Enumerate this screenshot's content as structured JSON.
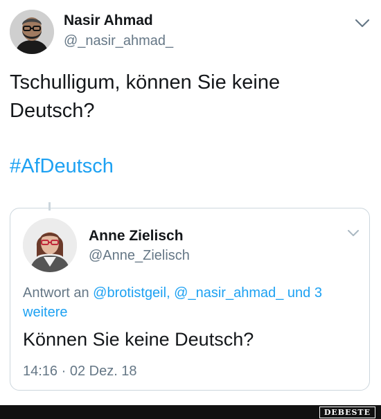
{
  "tweet": {
    "author_name": "Nasir Ahmad",
    "author_handle": "@_nasir_ahmad_",
    "text_line1": "Tschulligum, können Sie keine",
    "text_line2": "Deutsch?",
    "hashtag": "#AfDeutsch",
    "menu_icon": "chevron-down-icon"
  },
  "quoted_tweet": {
    "author_name": "Anne Zielisch",
    "author_handle": "@Anne_Zielisch",
    "reply_prefix": "Antwort an",
    "reply_mentions": "@brotistgeil, @_nasir_ahmad_ und 3 weitere",
    "text": "Können Sie keine Deutsch?",
    "timestamp": "14:16 · 02 Dez. 18",
    "menu_icon": "chevron-down-icon"
  },
  "watermark": {
    "text": "DEBESTE"
  },
  "colors": {
    "link": "#1da1f2",
    "secondary_text": "#657786",
    "primary_text": "#14171a",
    "border": "#ccd6dd"
  }
}
